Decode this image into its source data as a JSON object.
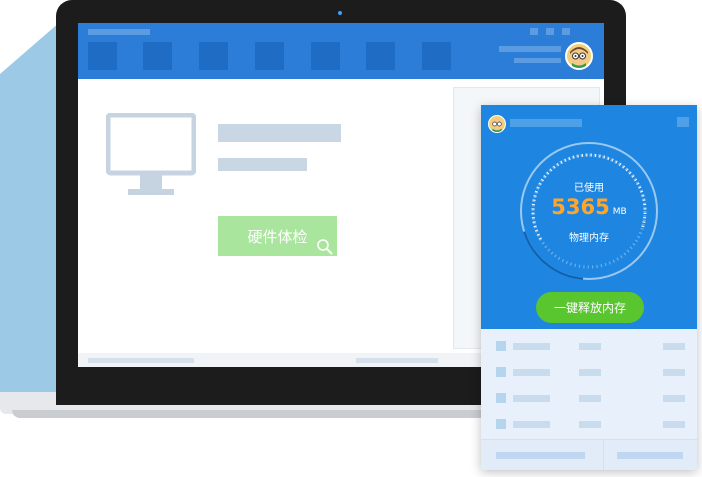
{
  "screen": {
    "checkup_button": "硬件体检"
  },
  "popup": {
    "gauge_label": "已使用",
    "memory_value": "5365",
    "memory_unit": "MB",
    "gauge_sublabel": "物理内存",
    "release_button": "一键释放内存"
  },
  "colors": {
    "header_blue": "#2b7dd7",
    "popup_blue": "#1e86e0",
    "checkup_green": "#a9e59c",
    "release_green": "#59c52f",
    "memory_orange": "#ffa52a"
  },
  "icons": [
    "monitor-icon",
    "search-icon",
    "avatar",
    "gauge-ring"
  ]
}
